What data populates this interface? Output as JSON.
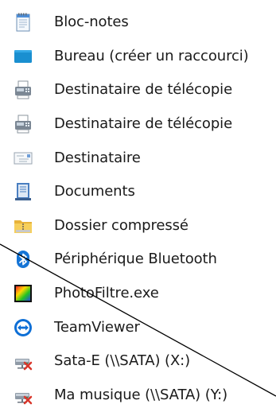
{
  "menu": {
    "items": [
      {
        "label": "Bloc-notes",
        "icon": "notepad-icon"
      },
      {
        "label": "Bureau (créer un raccourci)",
        "icon": "desktop-icon"
      },
      {
        "label": "Destinataire de télécopie",
        "icon": "fax-icon"
      },
      {
        "label": "Destinataire de télécopie",
        "icon": "fax-icon"
      },
      {
        "label": "Destinataire",
        "icon": "mail-recipient-icon"
      },
      {
        "label": "Documents",
        "icon": "documents-icon"
      },
      {
        "label": "Dossier compressé",
        "icon": "zip-folder-icon"
      },
      {
        "label": "Périphérique Bluetooth",
        "icon": "bluetooth-icon"
      },
      {
        "label": "PhotoFiltre.exe",
        "icon": "photofiltre-icon"
      },
      {
        "label": "TeamViewer",
        "icon": "teamviewer-icon"
      },
      {
        "label": "Sata-E (\\\\SATA) (X:)",
        "icon": "disconnected-network-drive-icon"
      },
      {
        "label": "Ma musique (\\\\SATA) (Y:)",
        "icon": "disconnected-network-drive-icon"
      }
    ]
  }
}
